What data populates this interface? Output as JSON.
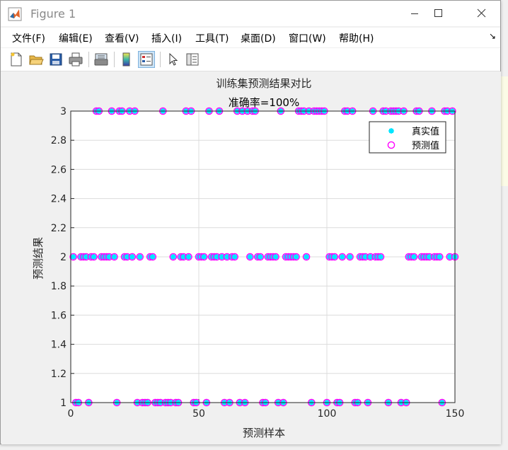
{
  "window": {
    "title": "Figure 1",
    "buttons": [
      "minimize",
      "maximize",
      "close"
    ]
  },
  "menu": {
    "items": [
      "文件(F)",
      "编辑(E)",
      "查看(V)",
      "插入(I)",
      "工具(T)",
      "桌面(D)",
      "窗口(W)",
      "帮助(H)"
    ]
  },
  "toolbar": {
    "icons": [
      "new-figure-icon",
      "open-file-icon",
      "save-icon",
      "print-icon",
      "print-preview-icon",
      "colorbar-icon",
      "legend-icon",
      "pointer-icon",
      "property-editor-icon"
    ]
  },
  "colors": {
    "true_marker": "#00e5ff",
    "pred_marker": "#ff00ff",
    "axes_bg": "#ffffff",
    "figure_bg": "#f0f0f0"
  },
  "chart_data": {
    "type": "scatter",
    "title": "训练集预测结果对比",
    "subtitle": "准确率=100%",
    "xlabel": "预测样本",
    "ylabel": "预测结果",
    "xlim": [
      0,
      150
    ],
    "ylim": [
      1,
      3
    ],
    "xticks": [
      0,
      50,
      100,
      150
    ],
    "yticks": [
      1,
      1.2,
      1.4,
      1.6,
      1.8,
      2,
      2.2,
      2.4,
      2.6,
      2.8,
      3
    ],
    "xtick_labels": [
      "0",
      "50",
      "100",
      "150"
    ],
    "ytick_labels": [
      "1",
      "1.2",
      "1.4",
      "1.6",
      "1.8",
      "2",
      "2.2",
      "2.4",
      "2.6",
      "2.8",
      "3"
    ],
    "grid": true,
    "legend_position": "top-right",
    "series": [
      {
        "name": "真实值",
        "marker": "asterisk",
        "color": "#00e5ff"
      },
      {
        "name": "预测值",
        "marker": "circle",
        "color": "#ff00ff"
      }
    ],
    "x": [
      1,
      2,
      3,
      4,
      5,
      6,
      7,
      8,
      9,
      10,
      11,
      12,
      13,
      14,
      15,
      16,
      17,
      18,
      19,
      20,
      21,
      22,
      23,
      24,
      25,
      26,
      27,
      28,
      29,
      30,
      31,
      32,
      33,
      34,
      35,
      36,
      37,
      38,
      39,
      40,
      41,
      42,
      43,
      44,
      45,
      46,
      47,
      48,
      49,
      50,
      51,
      52,
      53,
      54,
      55,
      56,
      57,
      58,
      59,
      60,
      61,
      62,
      63,
      64,
      65,
      66,
      67,
      68,
      69,
      70,
      71,
      72,
      73,
      74,
      75,
      76,
      77,
      78,
      79,
      80,
      81,
      82,
      83,
      84,
      85,
      86,
      87,
      88,
      89,
      90,
      91,
      92,
      93,
      94,
      95,
      96,
      97,
      98,
      99,
      100,
      101,
      102,
      103,
      104,
      105,
      106,
      107,
      108,
      109,
      110,
      111,
      112,
      113,
      114,
      115,
      116,
      117,
      118,
      119,
      120,
      121,
      122,
      123,
      124,
      125,
      126,
      127,
      128,
      129,
      130,
      131,
      132,
      133,
      134,
      135,
      136,
      137,
      138,
      139,
      140,
      141,
      142,
      143,
      144,
      145,
      146,
      147,
      148,
      149,
      150
    ],
    "y": [
      2,
      1,
      1,
      2,
      2,
      2,
      1,
      2,
      2,
      3,
      3,
      2,
      2,
      2,
      2,
      3,
      2,
      1,
      3,
      3,
      2,
      2,
      3,
      2,
      3,
      1,
      2,
      1,
      1,
      1,
      2,
      2,
      1,
      1,
      1,
      3,
      1,
      1,
      1,
      2,
      1,
      1,
      2,
      2,
      3,
      2,
      3,
      1,
      1,
      2,
      2,
      2,
      1,
      3,
      2,
      2,
      2,
      3,
      2,
      1,
      2,
      1,
      2,
      2,
      3,
      1,
      3,
      1,
      3,
      2,
      3,
      3,
      2,
      2,
      1,
      1,
      2,
      2,
      2,
      2,
      1,
      3,
      1,
      2,
      2,
      2,
      2,
      2,
      3,
      3,
      3,
      2,
      3,
      1,
      3,
      3,
      3,
      3,
      3,
      1,
      2,
      2,
      2,
      1,
      1,
      2,
      3,
      3,
      2,
      3,
      1,
      1,
      2,
      2,
      2,
      1,
      2,
      3,
      2,
      2,
      2,
      3,
      3,
      1,
      3,
      3,
      3,
      3,
      1,
      3,
      1,
      2,
      2,
      2,
      3,
      3,
      2,
      2,
      2,
      2,
      3,
      2,
      2,
      2,
      1,
      3,
      3,
      2,
      3,
      2
    ]
  }
}
